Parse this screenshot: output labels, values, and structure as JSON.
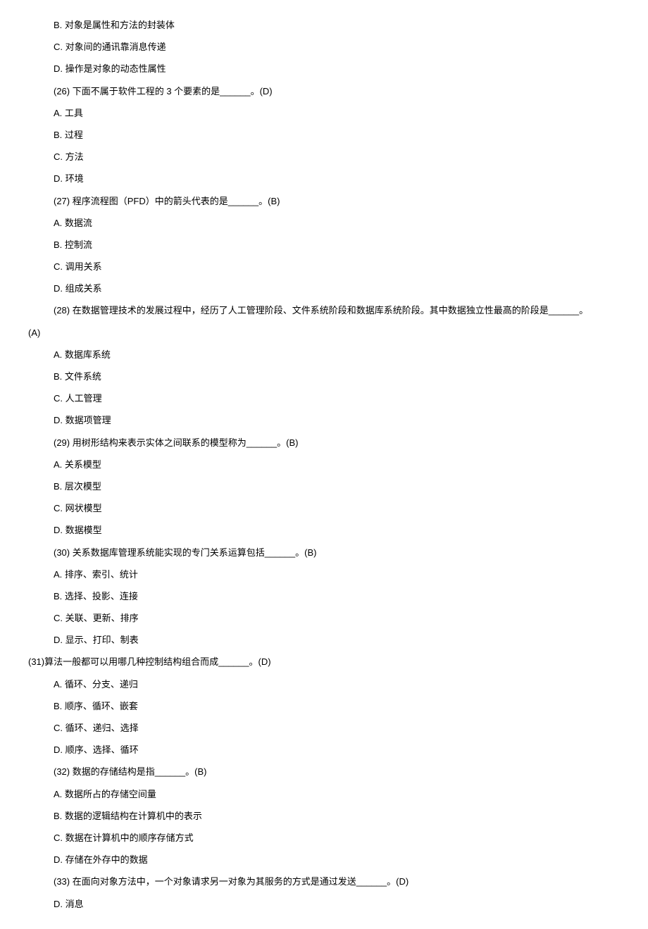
{
  "lines": [
    {
      "text": "B. 对象是属性和方法的封装体",
      "indent": "indent"
    },
    {
      "text": "C. 对象间的通讯靠消息传递",
      "indent": "indent"
    },
    {
      "text": "D. 操作是对象的动态性属性",
      "indent": "indent"
    },
    {
      "text": "(26) 下面不属于软件工程的 3 个要素的是______。(D)",
      "indent": "indent"
    },
    {
      "text": "A. 工具",
      "indent": "indent"
    },
    {
      "text": "B. 过程",
      "indent": "indent"
    },
    {
      "text": "C. 方法",
      "indent": "indent"
    },
    {
      "text": "D. 环境",
      "indent": "indent"
    },
    {
      "text": "(27) 程序流程图（PFD）中的箭头代表的是______。(B)",
      "indent": "indent"
    },
    {
      "text": "A. 数据流",
      "indent": "indent"
    },
    {
      "text": "B. 控制流",
      "indent": "indent"
    },
    {
      "text": "C. 调用关系",
      "indent": "indent"
    },
    {
      "text": "D. 组成关系",
      "indent": "indent"
    },
    {
      "text": "(28) 在数据管理技术的发展过程中，经历了人工管理阶段、文件系统阶段和数据库系统阶段。其中数据独立性最高的阶段是______。",
      "indent": "indent"
    },
    {
      "text": "(A)",
      "indent": "indent-small"
    },
    {
      "text": "A. 数据库系统",
      "indent": "indent"
    },
    {
      "text": "B. 文件系统",
      "indent": "indent"
    },
    {
      "text": "C. 人工管理",
      "indent": "indent"
    },
    {
      "text": "D. 数据项管理",
      "indent": "indent"
    },
    {
      "text": "(29) 用树形结构来表示实体之间联系的模型称为______。(B)",
      "indent": "indent"
    },
    {
      "text": "A. 关系模型",
      "indent": "indent"
    },
    {
      "text": "B. 层次模型",
      "indent": "indent"
    },
    {
      "text": "C. 网状模型",
      "indent": "indent"
    },
    {
      "text": "D. 数据模型",
      "indent": "indent"
    },
    {
      "text": "(30) 关系数据库管理系统能实现的专门关系运算包括______。(B)",
      "indent": "indent"
    },
    {
      "text": "A. 排序、索引、统计",
      "indent": "indent"
    },
    {
      "text": "B. 选择、投影、连接",
      "indent": "indent"
    },
    {
      "text": "C. 关联、更新、排序",
      "indent": "indent"
    },
    {
      "text": "D. 显示、打印、制表",
      "indent": "indent"
    },
    {
      "text": "(31)算法一般都可以用哪几种控制结构组合而成______。(D)",
      "indent": "indent-small"
    },
    {
      "text": "A. 循环、分支、递归",
      "indent": "indent"
    },
    {
      "text": "B. 顺序、循环、嵌套",
      "indent": "indent"
    },
    {
      "text": "C. 循环、递归、选择",
      "indent": "indent"
    },
    {
      "text": "D. 顺序、选择、循环",
      "indent": "indent"
    },
    {
      "text": "(32) 数据的存储结构是指______。(B)",
      "indent": "indent"
    },
    {
      "text": "A. 数据所占的存储空间量",
      "indent": "indent"
    },
    {
      "text": "B. 数据的逻辑结构在计算机中的表示",
      "indent": "indent"
    },
    {
      "text": "C. 数据在计算机中的顺序存储方式",
      "indent": "indent"
    },
    {
      "text": "D. 存储在外存中的数据",
      "indent": "indent"
    },
    {
      "text": "(33) 在面向对象方法中，一个对象请求另一对象为其服务的方式是通过发送______。(D)",
      "indent": "indent"
    },
    {
      "text": "D. 消息",
      "indent": "indent"
    }
  ]
}
